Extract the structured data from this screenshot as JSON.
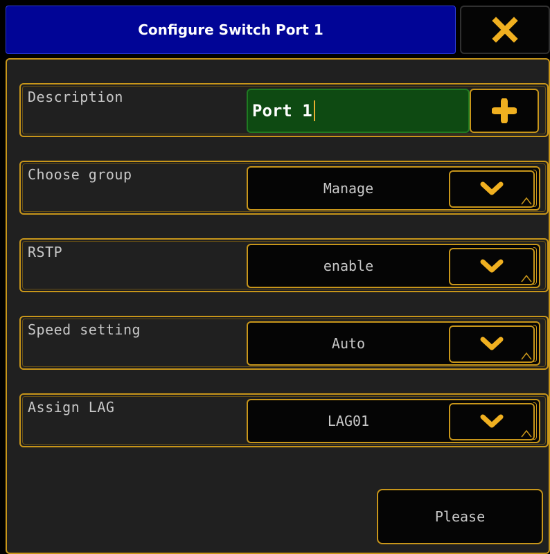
{
  "dialog": {
    "title": "Configure Switch Port 1",
    "close_icon": "close-icon"
  },
  "colors": {
    "title_bg": "#010596",
    "accent": "#c8961a",
    "panel_bg": "#202020",
    "input_bg": "#0e4a12",
    "icon": "#f0b020"
  },
  "fields": {
    "description": {
      "label": "Description",
      "value": "Port 1",
      "add_icon": "plus-icon"
    },
    "group": {
      "label": "Choose group",
      "value": "Manage"
    },
    "rstp": {
      "label": "RSTP",
      "value": "enable"
    },
    "speed": {
      "label": "Speed setting",
      "value": "Auto"
    },
    "lag": {
      "label": "Assign LAG",
      "value": "LAG01"
    }
  },
  "footer": {
    "button_label": "Please"
  }
}
